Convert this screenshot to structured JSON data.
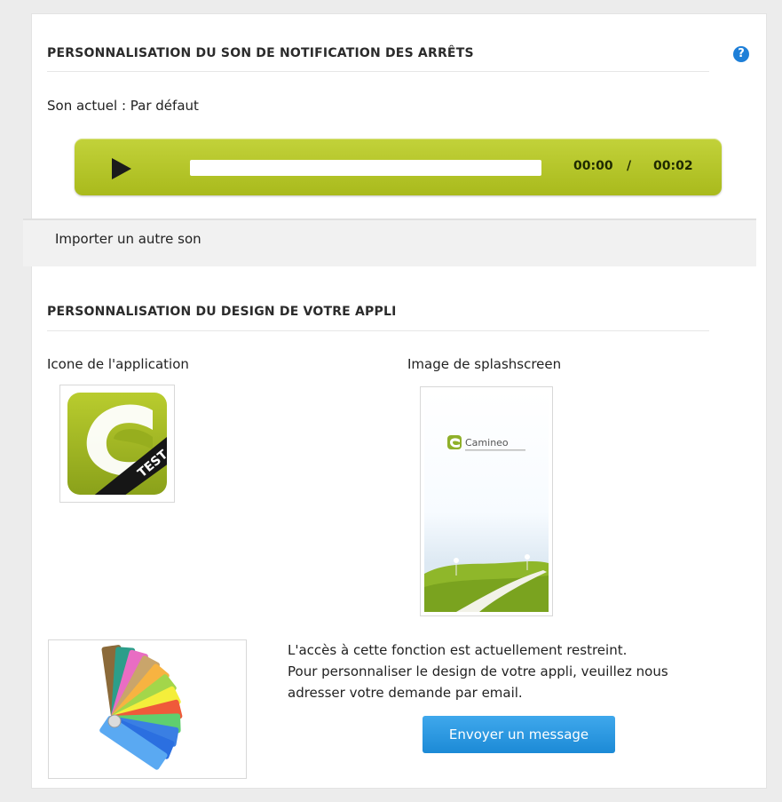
{
  "sound_section": {
    "title": "PERSONNALISATION DU SON DE NOTIFICATION DES ARRÊTS",
    "current_sound": "Son actuel : Par défaut",
    "player": {
      "current_time": "00:00",
      "separator": "/",
      "duration": "00:02",
      "progress": 0.0,
      "color": "#b5c52a"
    },
    "import_label": "Importer un autre son",
    "help_icon": "help-icon"
  },
  "design_section": {
    "title": "PERSONNALISATION DU DESIGN DE VOTRE APPLI",
    "app_icon_label": "Icone de l'application",
    "app_icon_badge": "TEST",
    "splash_label": "Image de splashscreen",
    "splash_brand": "Camineo",
    "notice": [
      "L'accès à cette fonction est actuellement restreint.",
      "Pour personnaliser le design de votre appli, veuillez nous",
      "adresser votre demande par email."
    ],
    "send_button": "Envoyer un message",
    "accent_color": "#1c8ad6"
  }
}
